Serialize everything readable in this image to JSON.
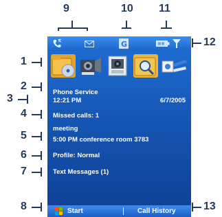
{
  "callouts": {
    "c1": "1",
    "c2": "2",
    "c3": "3",
    "c4": "4",
    "c5": "5",
    "c6": "6",
    "c7": "7",
    "c8": "8",
    "c9": "9",
    "c10": "10",
    "c11": "11",
    "c12": "12",
    "c13": "13"
  },
  "colors": {
    "callout": "#243a5a",
    "screen": "#1656b4",
    "text": "#ffffff"
  },
  "status_icons": [
    "call-icon",
    "envelope-icon",
    "g-network-icon",
    "battery-icon",
    "signal-icon"
  ],
  "app_icons": [
    "folder-disc-icon",
    "camera-film-icon",
    "photo-icon",
    "search-folder-icon",
    "media-player-icon"
  ],
  "today": {
    "operator": "Phone Service",
    "time": "12:21 PM",
    "date": "6/7/2005",
    "missed_calls": "Missed calls: 1",
    "appointment_title": "meeting",
    "appointment_detail": "5:00 PM conference room 3783",
    "profile": "Profile: Normal",
    "messages": "Text Messages (1)"
  },
  "softkeys": {
    "left": "Start",
    "right": "Call History"
  }
}
